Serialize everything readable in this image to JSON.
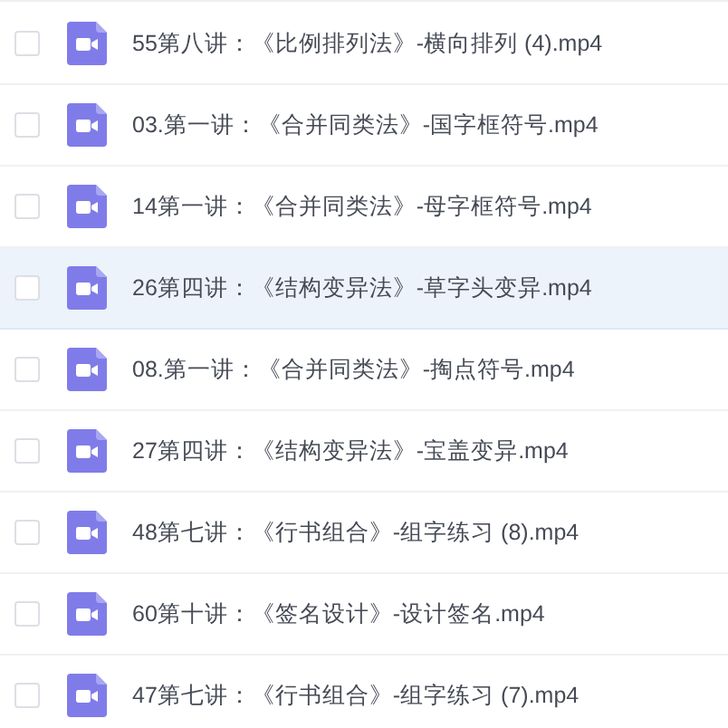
{
  "files": [
    {
      "name": "55第八讲：《比例排列法》-横向排列 (4).mp4",
      "checked": false,
      "highlighted": false
    },
    {
      "name": "03.第一讲：《合并同类法》-国字框符号.mp4",
      "checked": false,
      "highlighted": false
    },
    {
      "name": "14第一讲：《合并同类法》-母字框符号.mp4",
      "checked": false,
      "highlighted": false
    },
    {
      "name": "26第四讲：《结构变异法》-草字头变异.mp4",
      "checked": false,
      "highlighted": true
    },
    {
      "name": "08.第一讲：《合并同类法》-掏点符号.mp4",
      "checked": false,
      "highlighted": false
    },
    {
      "name": "27第四讲：《结构变异法》-宝盖变异.mp4",
      "checked": false,
      "highlighted": false
    },
    {
      "name": "48第七讲：《行书组合》-组字练习 (8).mp4",
      "checked": false,
      "highlighted": false
    },
    {
      "name": "60第十讲：《签名设计》-设计签名.mp4",
      "checked": false,
      "highlighted": false
    },
    {
      "name": "47第七讲：《行书组合》-组字练习 (7).mp4",
      "checked": false,
      "highlighted": false
    }
  ]
}
